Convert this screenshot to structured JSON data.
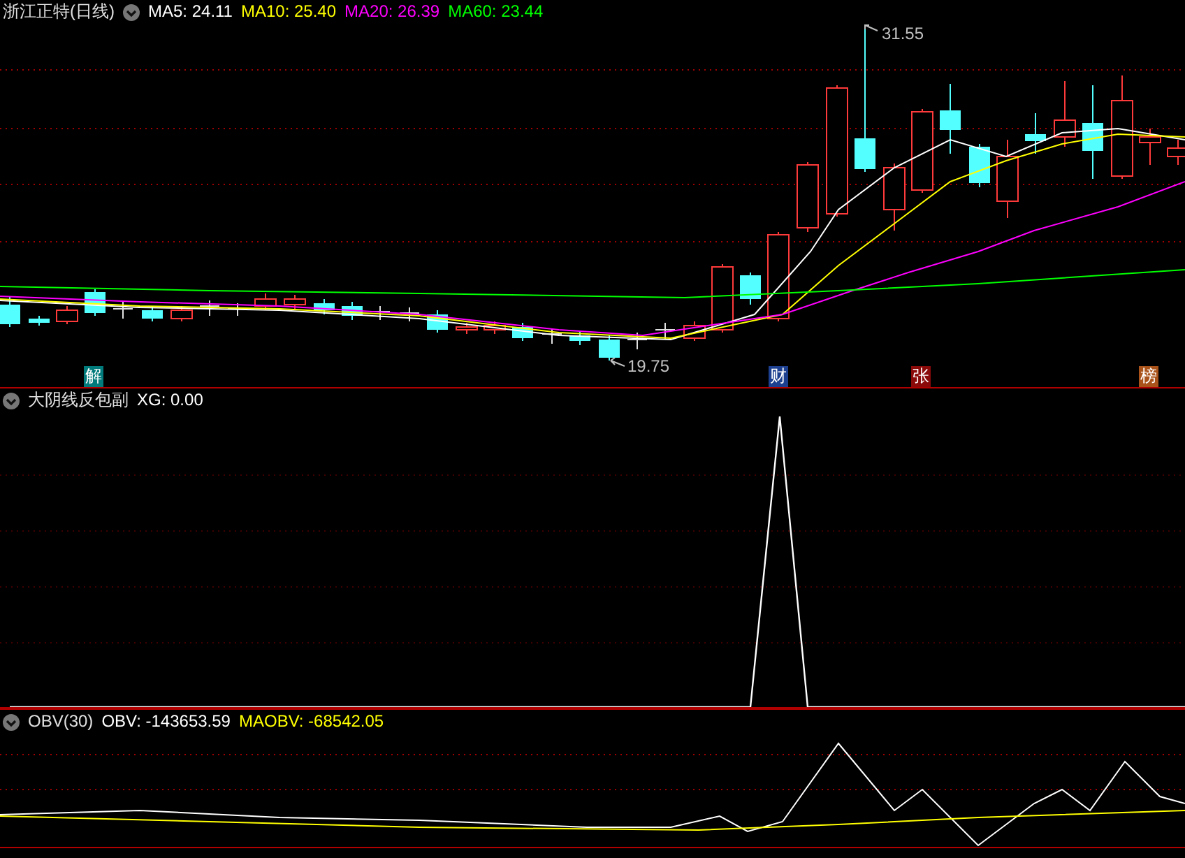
{
  "main_panel": {
    "title": "浙江正特(日线)",
    "legend": [
      {
        "label": "MA5: 24.11",
        "color": "#ffffff"
      },
      {
        "label": "MA10: 25.40",
        "color": "#ffff00"
      },
      {
        "label": "MA20: 26.39",
        "color": "#ff00ff"
      },
      {
        "label": "MA60: 23.44",
        "color": "#00ff00"
      }
    ],
    "high_label": "31.55",
    "low_label": "19.75",
    "markers": [
      {
        "label": "解",
        "color": "#007a7a"
      },
      {
        "label": "财",
        "color": "#1c3f8f"
      },
      {
        "label": "张",
        "color": "#8a0a0a"
      },
      {
        "label": "榜",
        "color": "#a9531a"
      }
    ]
  },
  "sub_panel": {
    "title": "大阴线反包副",
    "legend": [
      {
        "label": "XG: 0.00",
        "color": "#ffffff"
      }
    ]
  },
  "obv_panel": {
    "title": "OBV(30)",
    "legend": [
      {
        "label": "OBV: -143653.59",
        "color": "#ffffff"
      },
      {
        "label": "MAOBV: -68542.05",
        "color": "#ffff00"
      }
    ]
  }
}
